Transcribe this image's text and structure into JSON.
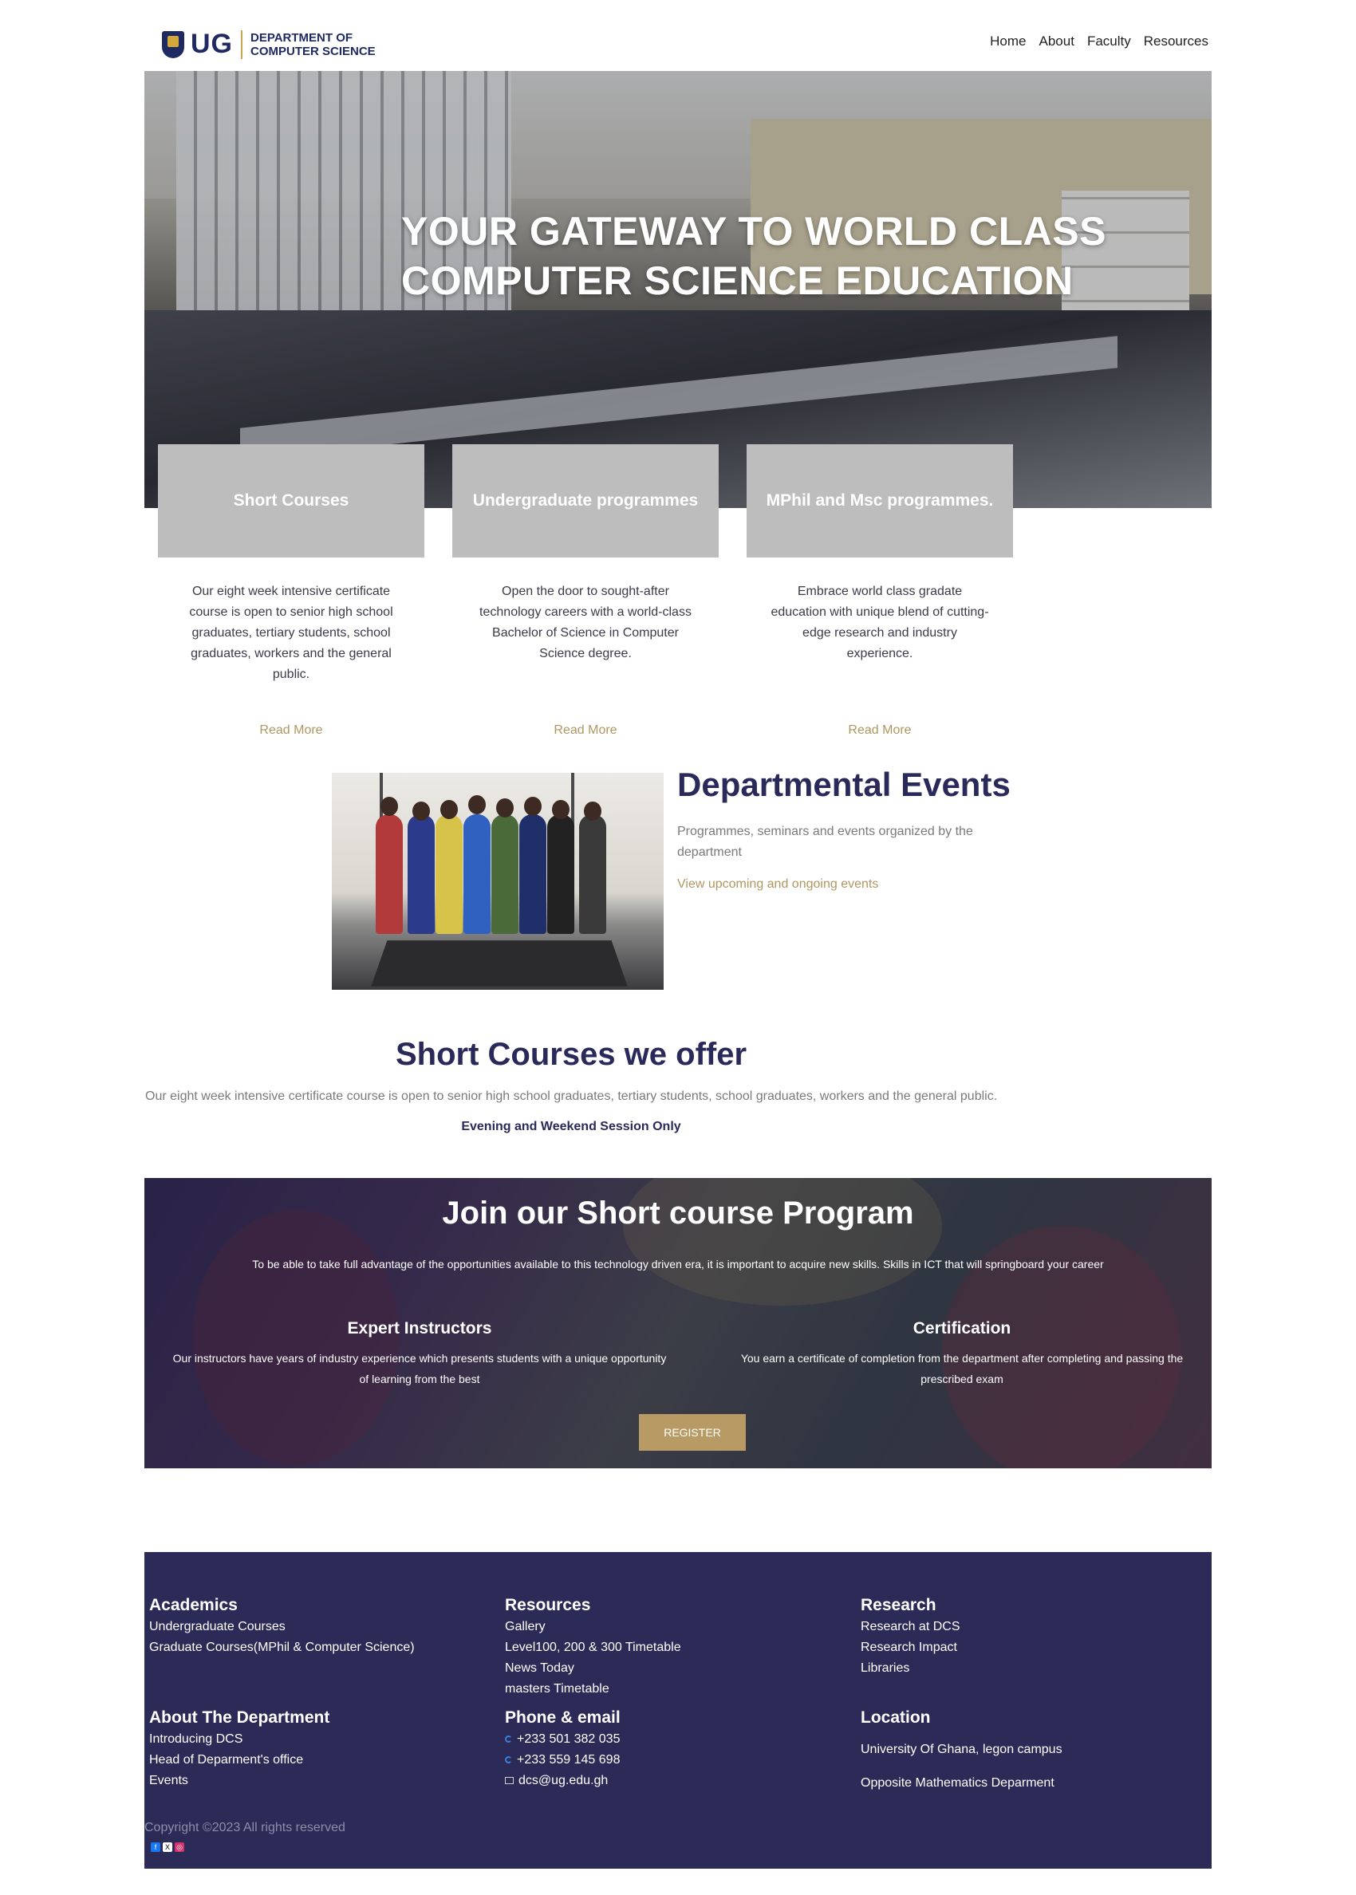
{
  "header": {
    "logo_abbrev": "UG",
    "logo_line1": "DEPARTMENT OF",
    "logo_line2": "COMPUTER SCIENCE",
    "nav": [
      "Home",
      "About",
      "Faculty",
      "Resources"
    ]
  },
  "hero": {
    "title_line1": "YOUR GATEWAY TO WORLD CLASS",
    "title_line2": "COMPUTER SCIENCE EDUCATION"
  },
  "programs": [
    {
      "title": "Short Courses",
      "description": "Our eight week intensive certificate course is open to senior high school graduates, tertiary students, school graduates, workers and the general public.",
      "link": "Read More"
    },
    {
      "title": "Undergraduate programmes",
      "description": "Open the door to sought-after technology careers with a world-class Bachelor of Science in Computer Science degree.",
      "link": "Read More"
    },
    {
      "title": "MPhil and Msc programmes.",
      "description": "Embrace world class gradate education with unique blend of cutting-edge research and industry experience.",
      "link": "Read More"
    }
  ],
  "events": {
    "title": "Departmental Events",
    "description": "Programmes, seminars and events organized by the department",
    "link": "View upcoming and ongoing events"
  },
  "short_courses": {
    "title": "Short Courses we offer",
    "description": "Our eight week intensive certificate course is open to senior high school graduates, tertiary students, school graduates, workers and the general public.",
    "session": "Evening and Weekend Session Only"
  },
  "join": {
    "title": "Join our Short course Program",
    "subtitle": "To be able to take full advantage of the opportunities available to this technology driven era, it is important to acquire new skills. Skills in ICT that will springboard your career",
    "features": [
      {
        "title": "Expert Instructors",
        "text": "Our instructors have years of industry experience which presents students with a unique opportunity of learning from the best"
      },
      {
        "title": "Certification",
        "text": "You earn a certificate of completion from the department after completing and passing the prescribed exam"
      }
    ],
    "button": "REGISTER"
  },
  "footer": {
    "academics": {
      "title": "Academics",
      "links": [
        "Undergraduate Courses",
        "Graduate Courses(MPhil & Computer Science)"
      ]
    },
    "resources": {
      "title": "Resources",
      "links": [
        "Gallery",
        "Level100, 200 & 300 Timetable",
        "News Today",
        "masters Timetable"
      ]
    },
    "research": {
      "title": "Research",
      "links": [
        "Research at DCS",
        "Research Impact",
        "Libraries"
      ]
    },
    "about": {
      "title": "About The Department",
      "links": [
        "Introducing DCS",
        "Head of Deparment's office",
        "Events"
      ]
    },
    "contact": {
      "title": "Phone & email",
      "phone1": "+233 501 382 035",
      "phone2": "+233 559 145 698",
      "email": "dcs@ug.edu.gh"
    },
    "location": {
      "title": "Location",
      "line1": "University Of Ghana, legon campus",
      "line2": "Opposite Mathematics Deparment"
    },
    "copyright": "Copyright ©2023 All rights reserved",
    "social_icons": [
      "facebook-icon",
      "x-icon",
      "instagram-icon"
    ]
  },
  "colors": {
    "navy": "#2c2a56",
    "gold": "#b89a64",
    "card_gray": "#bdbdbd"
  }
}
